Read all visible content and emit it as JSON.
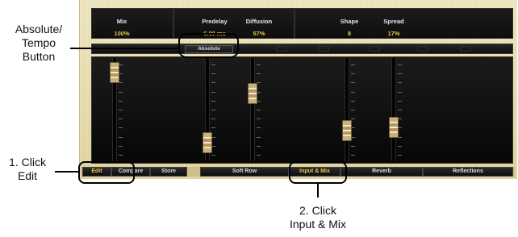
{
  "header": {
    "mix": {
      "label": "Mix",
      "value": "100%"
    },
    "predelay": {
      "label": "Predelay",
      "value": "6.00 ms"
    },
    "diffusion": {
      "label": "Diffusion",
      "value": "57%"
    },
    "shape": {
      "label": "Shape",
      "value": "8"
    },
    "spread": {
      "label": "Spread",
      "value": "17%"
    }
  },
  "absolute_button": {
    "label": "Absolute"
  },
  "tabs": {
    "edit": "Edit",
    "compare": "Compare",
    "store": "Store",
    "soft_row": "Soft Row",
    "input_mix": "Input & Mix",
    "reverb": "Reverb",
    "reflections": "Reflections"
  },
  "sliders": [
    {
      "name": "mix",
      "level": 0.95
    },
    {
      "name": "predelay",
      "level": 0.1
    },
    {
      "name": "diffusion",
      "level": 0.7
    },
    {
      "name": "shape",
      "level": 0.25
    },
    {
      "name": "spread",
      "level": 0.28
    }
  ],
  "annotations": {
    "abs_line1": "Absolute/",
    "abs_line2": "Tempo",
    "abs_line3": "Button",
    "edit_line1": "1. Click",
    "edit_line2": "Edit",
    "input_line1": "2. Click",
    "input_line2": "Input & Mix"
  },
  "colors": {
    "accent": "#e9c14a",
    "panel": "#101010",
    "frame": "#e9dfae"
  }
}
